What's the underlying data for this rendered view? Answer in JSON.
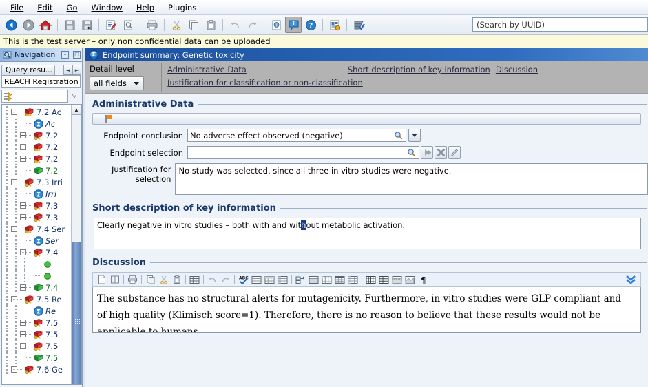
{
  "window": {
    "menu": [
      "File",
      "Edit",
      "Go",
      "Window",
      "Help",
      "Plugins"
    ],
    "notice": "This is the test server – only non confidential data can be uploaded"
  },
  "toolbar": {
    "items": [
      {
        "name": "back-icon",
        "label": "Back"
      },
      {
        "name": "forward-icon",
        "label": "Forward"
      },
      {
        "name": "home-icon",
        "label": "Home"
      },
      {
        "name": "save-icon",
        "label": "Save"
      },
      {
        "name": "save-close-icon",
        "label": "Save and close"
      },
      {
        "name": "edit-icon",
        "label": "Edit"
      },
      {
        "name": "preview-icon",
        "label": "Preview"
      },
      {
        "name": "print-icon",
        "label": "Print"
      },
      {
        "name": "cut-icon",
        "label": "Cut"
      },
      {
        "name": "copy-icon",
        "label": "Copy"
      },
      {
        "name": "paste-icon",
        "label": "Paste"
      },
      {
        "name": "undo-icon",
        "label": "Undo"
      },
      {
        "name": "redo-icon",
        "label": "Redo"
      },
      {
        "name": "document-info-icon",
        "label": "Document information"
      },
      {
        "name": "info-panel-icon",
        "label": "Information panel"
      },
      {
        "name": "help-icon",
        "label": "Help"
      },
      {
        "name": "report-icon",
        "label": "Report"
      },
      {
        "name": "validate-icon",
        "label": "Validation assistant"
      }
    ],
    "search_placeholder": "(Search by UUID)"
  },
  "navigation": {
    "title": "Navigation",
    "minimize_label": "–",
    "maximize_label": "□",
    "tab_label": "Query resu...",
    "prev_label": "◄",
    "next_label": "►",
    "dataset_label": "REACH Registration",
    "filter_value": "",
    "filter_arrow": "▽",
    "tree": [
      {
        "indent": 1,
        "toggle": "-",
        "icon": "book-red-key-icon",
        "label": "7.2 Ac",
        "style": "normal"
      },
      {
        "indent": 2,
        "toggle": "",
        "icon": "sigma-blue-icon",
        "label": "Ac",
        "style": "italic"
      },
      {
        "indent": 2,
        "toggle": "+",
        "icon": "book-red-key-icon",
        "label": "7.2",
        "style": "normal"
      },
      {
        "indent": 2,
        "toggle": "+",
        "icon": "book-red-key-icon",
        "label": "7.2",
        "style": "normal"
      },
      {
        "indent": 2,
        "toggle": "+",
        "icon": "book-red-key-icon",
        "label": "7.2",
        "style": "normal"
      },
      {
        "indent": 2,
        "toggle": "",
        "icon": "book-green-icon",
        "label": "7.2",
        "style": "green"
      },
      {
        "indent": 1,
        "toggle": "-",
        "icon": "book-red-key-icon",
        "label": "7.3 Irri",
        "style": "normal"
      },
      {
        "indent": 2,
        "toggle": "",
        "icon": "sigma-blue-icon",
        "label": "Irri",
        "style": "italic"
      },
      {
        "indent": 2,
        "toggle": "+",
        "icon": "book-red-key-icon",
        "label": "7.3",
        "style": "normal"
      },
      {
        "indent": 2,
        "toggle": "+",
        "icon": "book-red-key-icon",
        "label": "7.3",
        "style": "normal"
      },
      {
        "indent": 1,
        "toggle": "-",
        "icon": "book-red-key-icon",
        "label": "7.4 Ser",
        "style": "normal"
      },
      {
        "indent": 2,
        "toggle": "",
        "icon": "sigma-blue-icon",
        "label": "Ser",
        "style": "italic"
      },
      {
        "indent": 2,
        "toggle": "-",
        "icon": "book-red-key-icon",
        "label": "7.4",
        "style": "normal"
      },
      {
        "indent": 3,
        "toggle": "",
        "icon": "green-dot-icon",
        "label": "",
        "style": "normal"
      },
      {
        "indent": 3,
        "toggle": "",
        "icon": "green-dot-icon",
        "label": "",
        "style": "normal"
      },
      {
        "indent": 2,
        "toggle": "+",
        "icon": "book-green-icon",
        "label": "7.4",
        "style": "green"
      },
      {
        "indent": 1,
        "toggle": "-",
        "icon": "book-red-key-icon",
        "label": "7.5 Re",
        "style": "normal"
      },
      {
        "indent": 2,
        "toggle": "",
        "icon": "sigma-blue-icon",
        "label": "Re",
        "style": "italic"
      },
      {
        "indent": 2,
        "toggle": "+",
        "icon": "book-red-key-icon",
        "label": "7.5",
        "style": "normal"
      },
      {
        "indent": 2,
        "toggle": "+",
        "icon": "book-red-key-icon",
        "label": "7.5",
        "style": "normal"
      },
      {
        "indent": 2,
        "toggle": "+",
        "icon": "book-red-key-icon",
        "label": "7.5",
        "style": "normal"
      },
      {
        "indent": 2,
        "toggle": "",
        "icon": "book-green-icon",
        "label": "7.5",
        "style": "green"
      },
      {
        "indent": 1,
        "toggle": "-",
        "icon": "book-red-key-icon",
        "label": "7.6 Ge",
        "style": "normal"
      }
    ]
  },
  "main": {
    "title": "Endpoint summary: Genetic toxicity",
    "detail_level_label": "Detail level",
    "detail_level_value": "all fields",
    "links": {
      "administrative_data": "Administrative Data",
      "short_description": "Short description of key information",
      "discussion": "Discussion",
      "justification": "Justification for classification or non-classification"
    },
    "administrative": {
      "heading": "Administrative Data",
      "endpoint_conclusion_label": "Endpoint conclusion",
      "endpoint_conclusion_value": "No adverse effect observed (negative)",
      "endpoint_selection_label": "Endpoint selection",
      "endpoint_selection_value": "",
      "justification_label": "Justification for selection",
      "justification_value": "No study was selected, since all three  in vitro studies were negative."
    },
    "short_description": {
      "heading": "Short description of key information",
      "text_before": "Clearly negative in vitro studies – both with and wit",
      "text_selected": "h",
      "text_after": "out metabolic activation."
    },
    "discussion": {
      "heading": "Discussion",
      "line1": "The substance has no structural alerts for mutagenicity. Furthermore, in vitro studies were GLP compliant and",
      "line2": "of high quality (Klimisch score=1). Therefore, there is no reason to believe that these results would not be applicable to humans.",
      "toolbar": [
        {
          "name": "new-document-icon"
        },
        {
          "name": "open-document-icon"
        },
        {
          "name": "print-icon"
        },
        {
          "name": "copy-icon"
        },
        {
          "name": "cut-icon"
        },
        {
          "name": "paste-icon"
        },
        {
          "name": "table-icon"
        },
        {
          "name": "undo-icon"
        },
        {
          "name": "redo-icon"
        },
        {
          "name": "spellcheck-icon"
        },
        {
          "name": "insert-table-icon"
        },
        {
          "name": "table-row-icon"
        },
        {
          "name": "table-column-icon"
        },
        {
          "name": "indent-icon"
        },
        {
          "name": "table-style-1-icon"
        },
        {
          "name": "table-style-2-icon"
        },
        {
          "name": "table-style-3-icon"
        },
        {
          "name": "table-style-4-icon"
        },
        {
          "name": "grid-icon"
        },
        {
          "name": "grid-alt-icon"
        },
        {
          "name": "image-table-icon"
        },
        {
          "name": "image-table-alt-icon"
        },
        {
          "name": "pilcrow-icon"
        }
      ],
      "expand_label": "expand-toolbar"
    }
  },
  "colors": {
    "title_bar": "#1b4f9c",
    "detail_bar": "#b3b3b3",
    "section_heading": "#1b3a6b",
    "selection": "#173b86",
    "notice_bg": "#fbfbdc"
  }
}
